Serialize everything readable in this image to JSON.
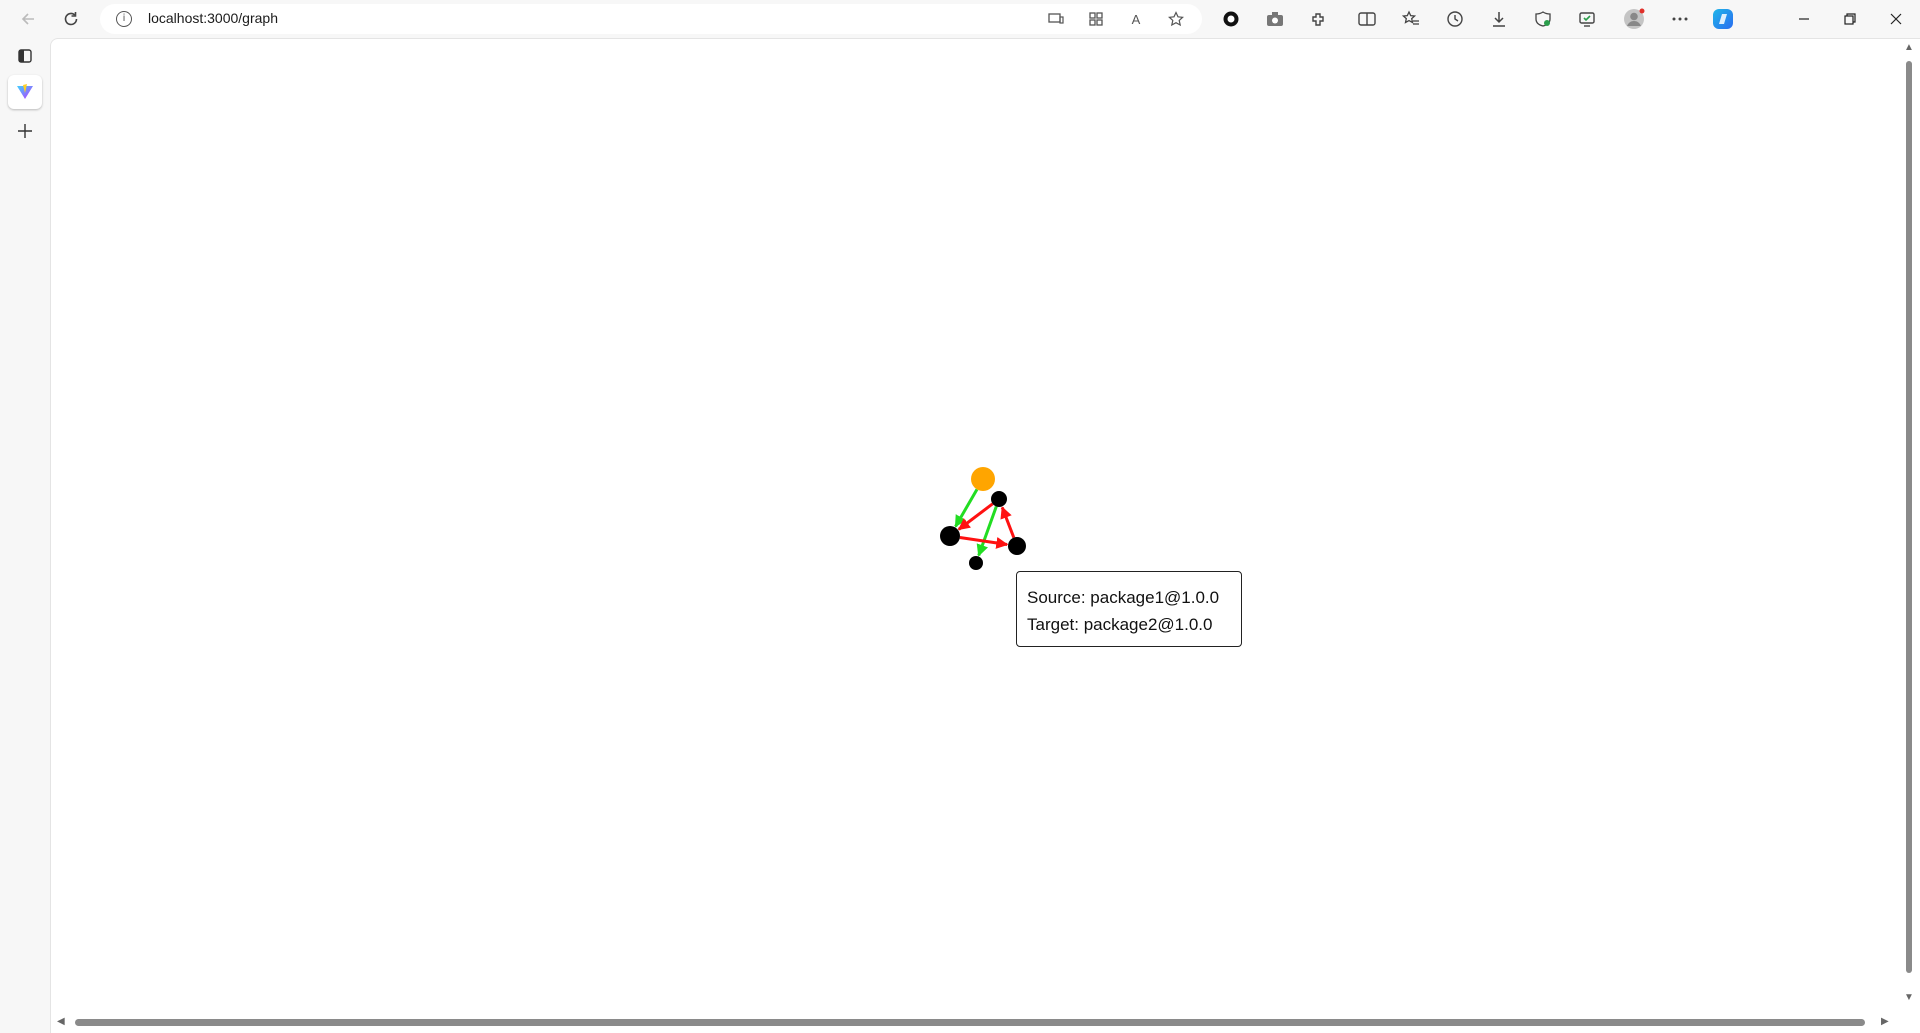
{
  "browser": {
    "url": "localhost:3000/graph",
    "window_controls": [
      "minimize",
      "restore",
      "close"
    ]
  },
  "graph": {
    "nodes": [
      {
        "id": "n0",
        "color": "#FFA500",
        "highlighted": true
      },
      {
        "id": "n1",
        "color": "#000000"
      },
      {
        "id": "n2",
        "color": "#000000"
      },
      {
        "id": "n3",
        "color": "#000000"
      },
      {
        "id": "n4",
        "color": "#000000"
      }
    ],
    "edges": [
      {
        "source": "n0",
        "target": "n2",
        "color": "#22dd22"
      },
      {
        "source": "n1",
        "target": "n4",
        "color": "#22dd22"
      },
      {
        "source": "n1",
        "target": "n2",
        "color": "#ff1111"
      },
      {
        "source": "n2",
        "target": "n3",
        "color": "#ff1111"
      },
      {
        "source": "n3",
        "target": "n1",
        "color": "#ff1111"
      }
    ]
  },
  "tooltip": {
    "source_line": "Source: package1@1.0.0",
    "target_line": "Target: package2@1.0.0"
  },
  "colors": {
    "dependency_edge": "#22dd22",
    "cycle_edge": "#ff1111",
    "root_node": "#FFA500",
    "node": "#000000"
  }
}
